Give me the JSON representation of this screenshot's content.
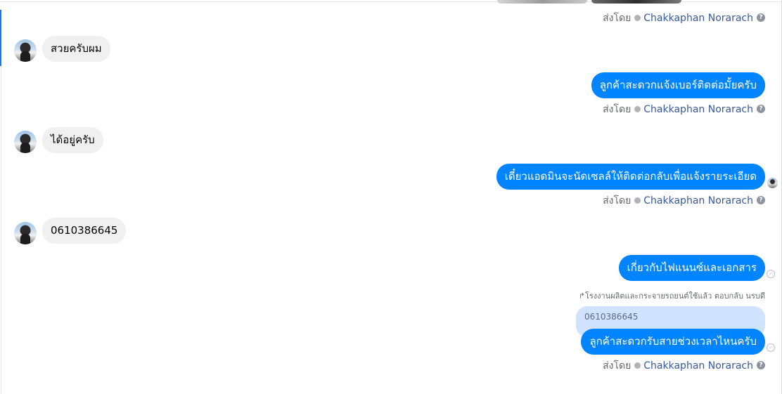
{
  "messages": {
    "received": [
      {
        "text": "สวยครับผม"
      },
      {
        "text": "ได้อยู่ครับ"
      },
      {
        "text": "0610386645"
      }
    ],
    "sent": [
      {
        "text": "ลูกค้าสะดวกแจ้งเบอร์ติดต่อมั้ยครับ"
      },
      {
        "text": "เดี๋ยวแอดมินจะนัดเซลล์ให้ติดต่อกลับเพื่อแจ้งรายระเอียด"
      },
      {
        "text": "เกี่ยวกับไฟแนนซ์และเอกสาร"
      },
      {
        "text": "ลูกค้าสะดวกรับสายช่วงเวลาไหนครับ"
      }
    ]
  },
  "sent_by": {
    "label": "ส่งโดย",
    "author": "Chakkaphan Norarach"
  },
  "reply": {
    "caption": "โรงงานผลิตและกระจายรถยนต์ใช้แล้ว ตอบกลับ นรบดี",
    "quoted_text": "0610386645"
  },
  "icons": {
    "help": "question-circle-icon",
    "status": "delivered-check-icon",
    "reply": "reply-arrow-icon"
  },
  "colors": {
    "sent_bubble": "#0084ff",
    "received_bubble": "#f0f0f0",
    "quote_bubble": "#cfe3fe",
    "author_link": "#385898"
  }
}
